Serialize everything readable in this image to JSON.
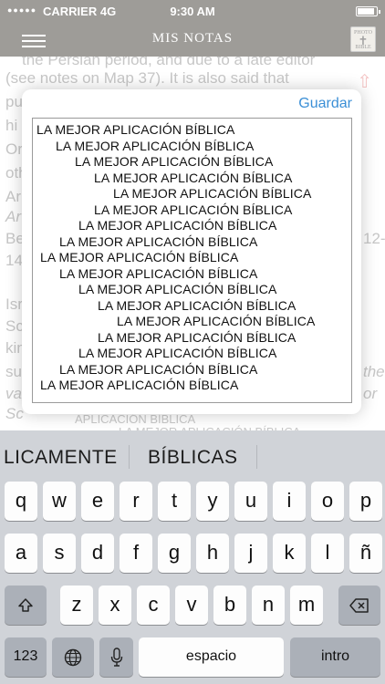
{
  "status": {
    "signal": "●●●●●",
    "carrier": "CARRIER 4G",
    "time": "9:30 AM",
    "battery_level": 0.95
  },
  "nav": {
    "title": "MIS NOTAS",
    "logo_text": [
      "PHOTO",
      "BIBLE"
    ]
  },
  "background_doc": {
    "lines": [
      "the Persian period, and due to a late editor",
      "(see notes on Map 37). It is also said that"
    ],
    "left_fragments": [
      "pu",
      "hi",
      "Or",
      "oth",
      "Ar",
      "Ar",
      "Be",
      "14",
      "Isr",
      "Sc",
      "kin",
      "su",
      "va",
      "Sc"
    ],
    "right_fragments": [
      "12-",
      "the",
      "or"
    ],
    "overflow_lines": [
      "APLICACIÓN BÍBLICA",
      "LA MEJOR APLICACIÓN BÍBLICA"
    ]
  },
  "modal": {
    "save_label": "Guardar",
    "notes": [
      "LA MEJOR APLICACIÓN BÍBLICA",
      "LA MEJOR APLICACIÓN BÍBLICA",
      "LA MEJOR APLICACIÓN BÍBLICA",
      "LA MEJOR APLICACIÓN BÍBLICA",
      "LA MEJOR APLICACIÓN BÍBLICA",
      "LA MEJOR APLICACIÓN BÍBLICA",
      "LA MEJOR APLICACIÓN BÍBLICA",
      "LA MEJOR APLICACIÓN BÍBLICA",
      "LA MEJOR APLICACIÓN BÍBLICA",
      "LA MEJOR APLICACIÓN BÍBLICA",
      "LA MEJOR APLICACIÓN BÍBLICA",
      "LA MEJOR APLICACIÓN BÍBLICA",
      "LA MEJOR APLICACIÓN BÍBLICA",
      "LA MEJOR APLICACIÓN BÍBLICA",
      "LA MEJOR APLICACIÓN BÍBLICA",
      "LA MEJOR APLICACIÓN BÍBLICA",
      "LA MEJOR APLICACIÓN BÍBLICA"
    ]
  },
  "keyboard": {
    "suggestions": [
      "LICAMENTE",
      "BÍBLICAS"
    ],
    "row1": [
      "q",
      "w",
      "e",
      "r",
      "t",
      "y",
      "u",
      "i",
      "o",
      "p"
    ],
    "row2": [
      "a",
      "s",
      "d",
      "f",
      "g",
      "h",
      "j",
      "k",
      "l",
      "ñ"
    ],
    "row3": [
      "z",
      "x",
      "c",
      "v",
      "b",
      "n",
      "m"
    ],
    "numbers_label": "123",
    "space_label": "espacio",
    "return_label": "intro"
  }
}
